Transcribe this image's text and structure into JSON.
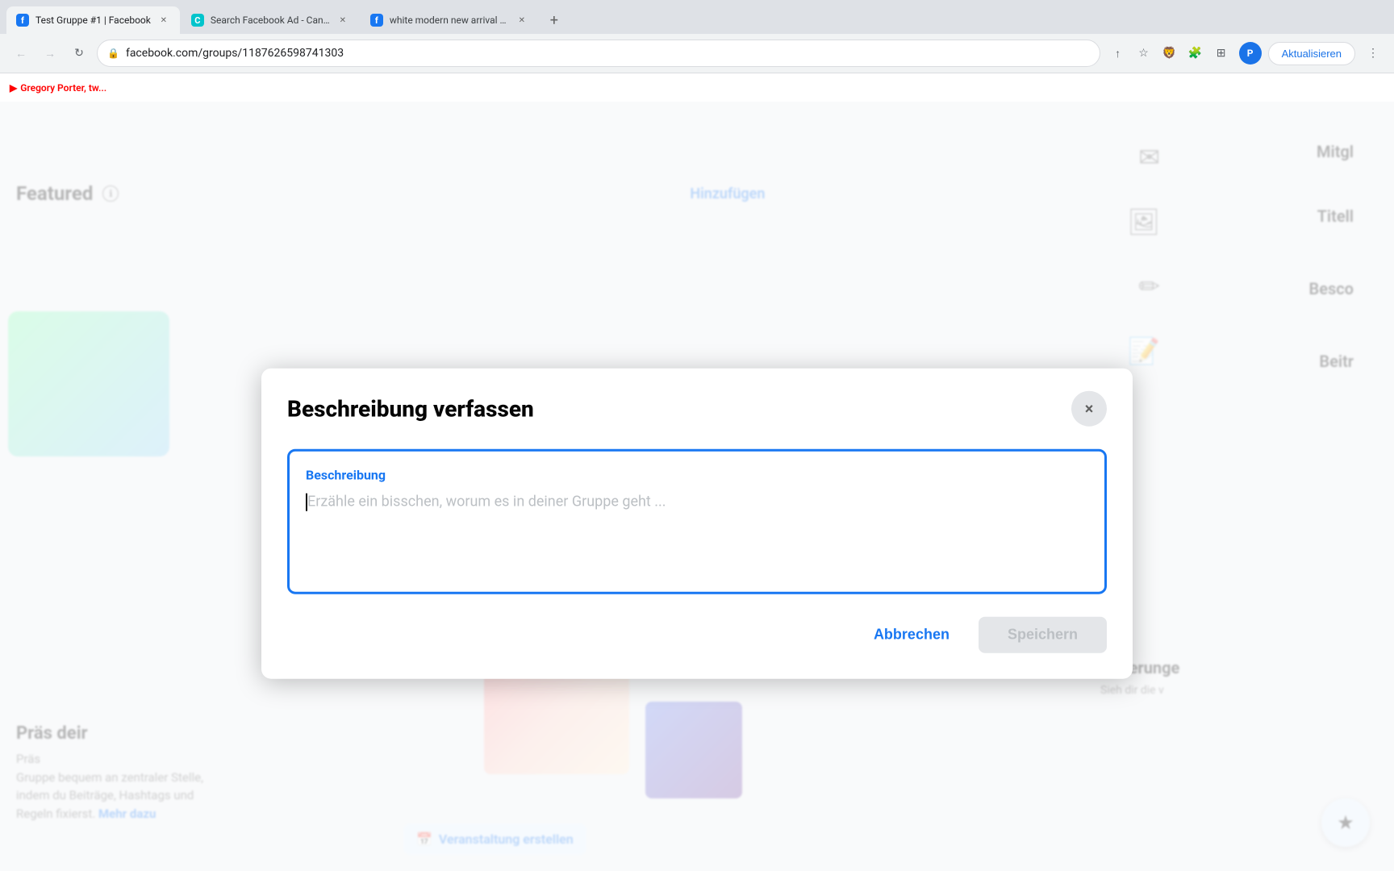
{
  "browser": {
    "tabs": [
      {
        "id": "tab-facebook",
        "label": "Test Gruppe #1 | Facebook",
        "favicon_color": "#1877f2",
        "favicon_letter": "f",
        "active": true
      },
      {
        "id": "tab-canva",
        "label": "Search Facebook Ad - Canva",
        "favicon_color": "#00c4cc",
        "favicon_letter": "C",
        "active": false
      },
      {
        "id": "tab-white",
        "label": "white modern new arrival watc...",
        "favicon_color": "#1877f2",
        "favicon_letter": "f",
        "active": false
      }
    ],
    "address": "facebook.com/groups/1187626598741303",
    "update_button": "Aktualisieren",
    "yt_label": "Gregory Porter, tw..."
  },
  "page": {
    "featured_label": "Featured",
    "hinzufugen_label": "Hinzufügen",
    "mitgl_label": "Mitgl",
    "titel_label": "Titell",
    "besc_label": "Besco",
    "beitr_label": "Beitr",
    "anderung_title": "Änderunge",
    "anderung_text": "Sieh dir die v",
    "promo_title": "Präs deir",
    "promo_text_1": "Präs",
    "promo_text_2": "Gruppe bequem an zentraler Stelle,",
    "promo_text_3": "indem du Beiträge, Hashtags und",
    "promo_text_4": "Regeln fixierst.",
    "promo_mehr": "Mehr dazu",
    "event_btn_label": "Veranstaltung erstellen"
  },
  "modal": {
    "title": "Beschreibung verfassen",
    "close_icon": "×",
    "textarea_label": "Beschreibung",
    "textarea_placeholder": "Erzähle ein bisschen, worum es in deiner Gruppe geht ...",
    "cancel_label": "Abbrechen",
    "save_label": "Speichern"
  },
  "icons": {
    "info": "ℹ",
    "close": "✕",
    "back": "←",
    "forward": "→",
    "reload": "↻",
    "star": "☆",
    "shield": "🛡",
    "puzzle": "🧩",
    "grid": "⊞",
    "menu": "⋮",
    "lock": "🔒",
    "share": "↑",
    "bookmark": "☆",
    "mail": "✉",
    "image": "🖼",
    "pencil": "✏",
    "edit": "📝",
    "calendar": "📅",
    "star_filled": "★",
    "youtube": "▶"
  }
}
